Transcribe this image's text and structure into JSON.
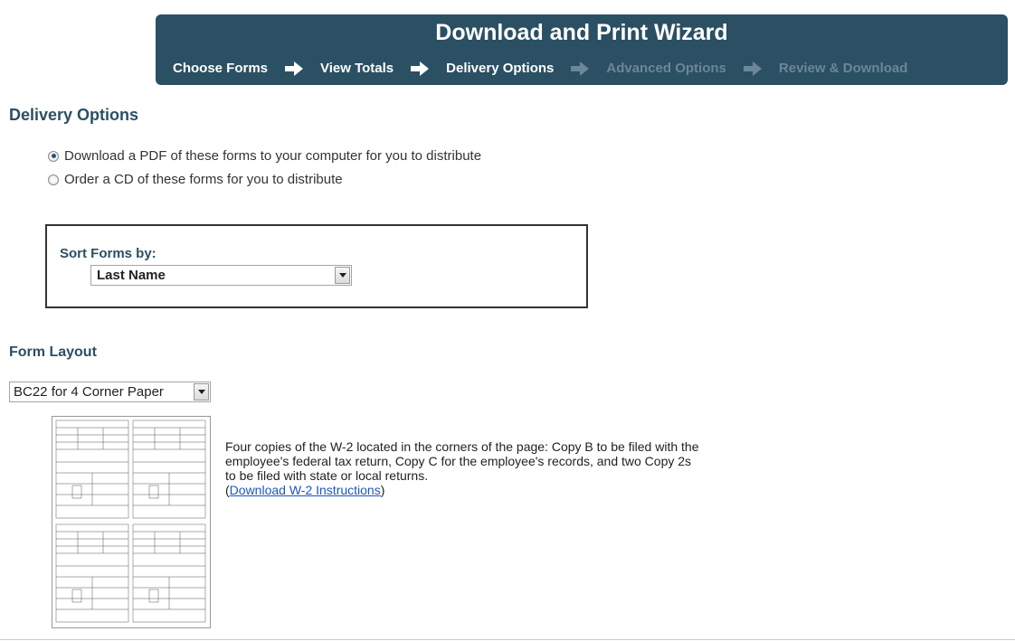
{
  "wizard": {
    "title": "Download and Print Wizard",
    "steps": [
      {
        "label": "Choose Forms",
        "active": true
      },
      {
        "label": "View Totals",
        "active": true
      },
      {
        "label": "Delivery Options",
        "active": true
      },
      {
        "label": "Advanced Options",
        "active": false
      },
      {
        "label": "Review & Download",
        "active": false
      }
    ]
  },
  "delivery": {
    "title": "Delivery Options",
    "options": [
      {
        "label": "Download a PDF of these forms to your computer for you to distribute",
        "checked": true
      },
      {
        "label": "Order a CD of these forms for you to distribute",
        "checked": false
      }
    ]
  },
  "sort": {
    "label": "Sort Forms by:",
    "selected": "Last Name"
  },
  "layout": {
    "title": "Form Layout",
    "selected": "BC22 for 4 Corner Paper",
    "description": "Four copies of the W-2 located in the corners of the page: Copy B to be filed with the employee's federal tax return, Copy C for the employee's records, and two Copy 2s to be filed with state or local returns.",
    "link_open": "(",
    "link_text": "Download W-2 Instructions",
    "link_close": ")"
  },
  "colors": {
    "header_bg": "#2b4f63",
    "active_step": "#ffffff",
    "inactive_step": "#6c8797",
    "link": "#1b55c5"
  }
}
